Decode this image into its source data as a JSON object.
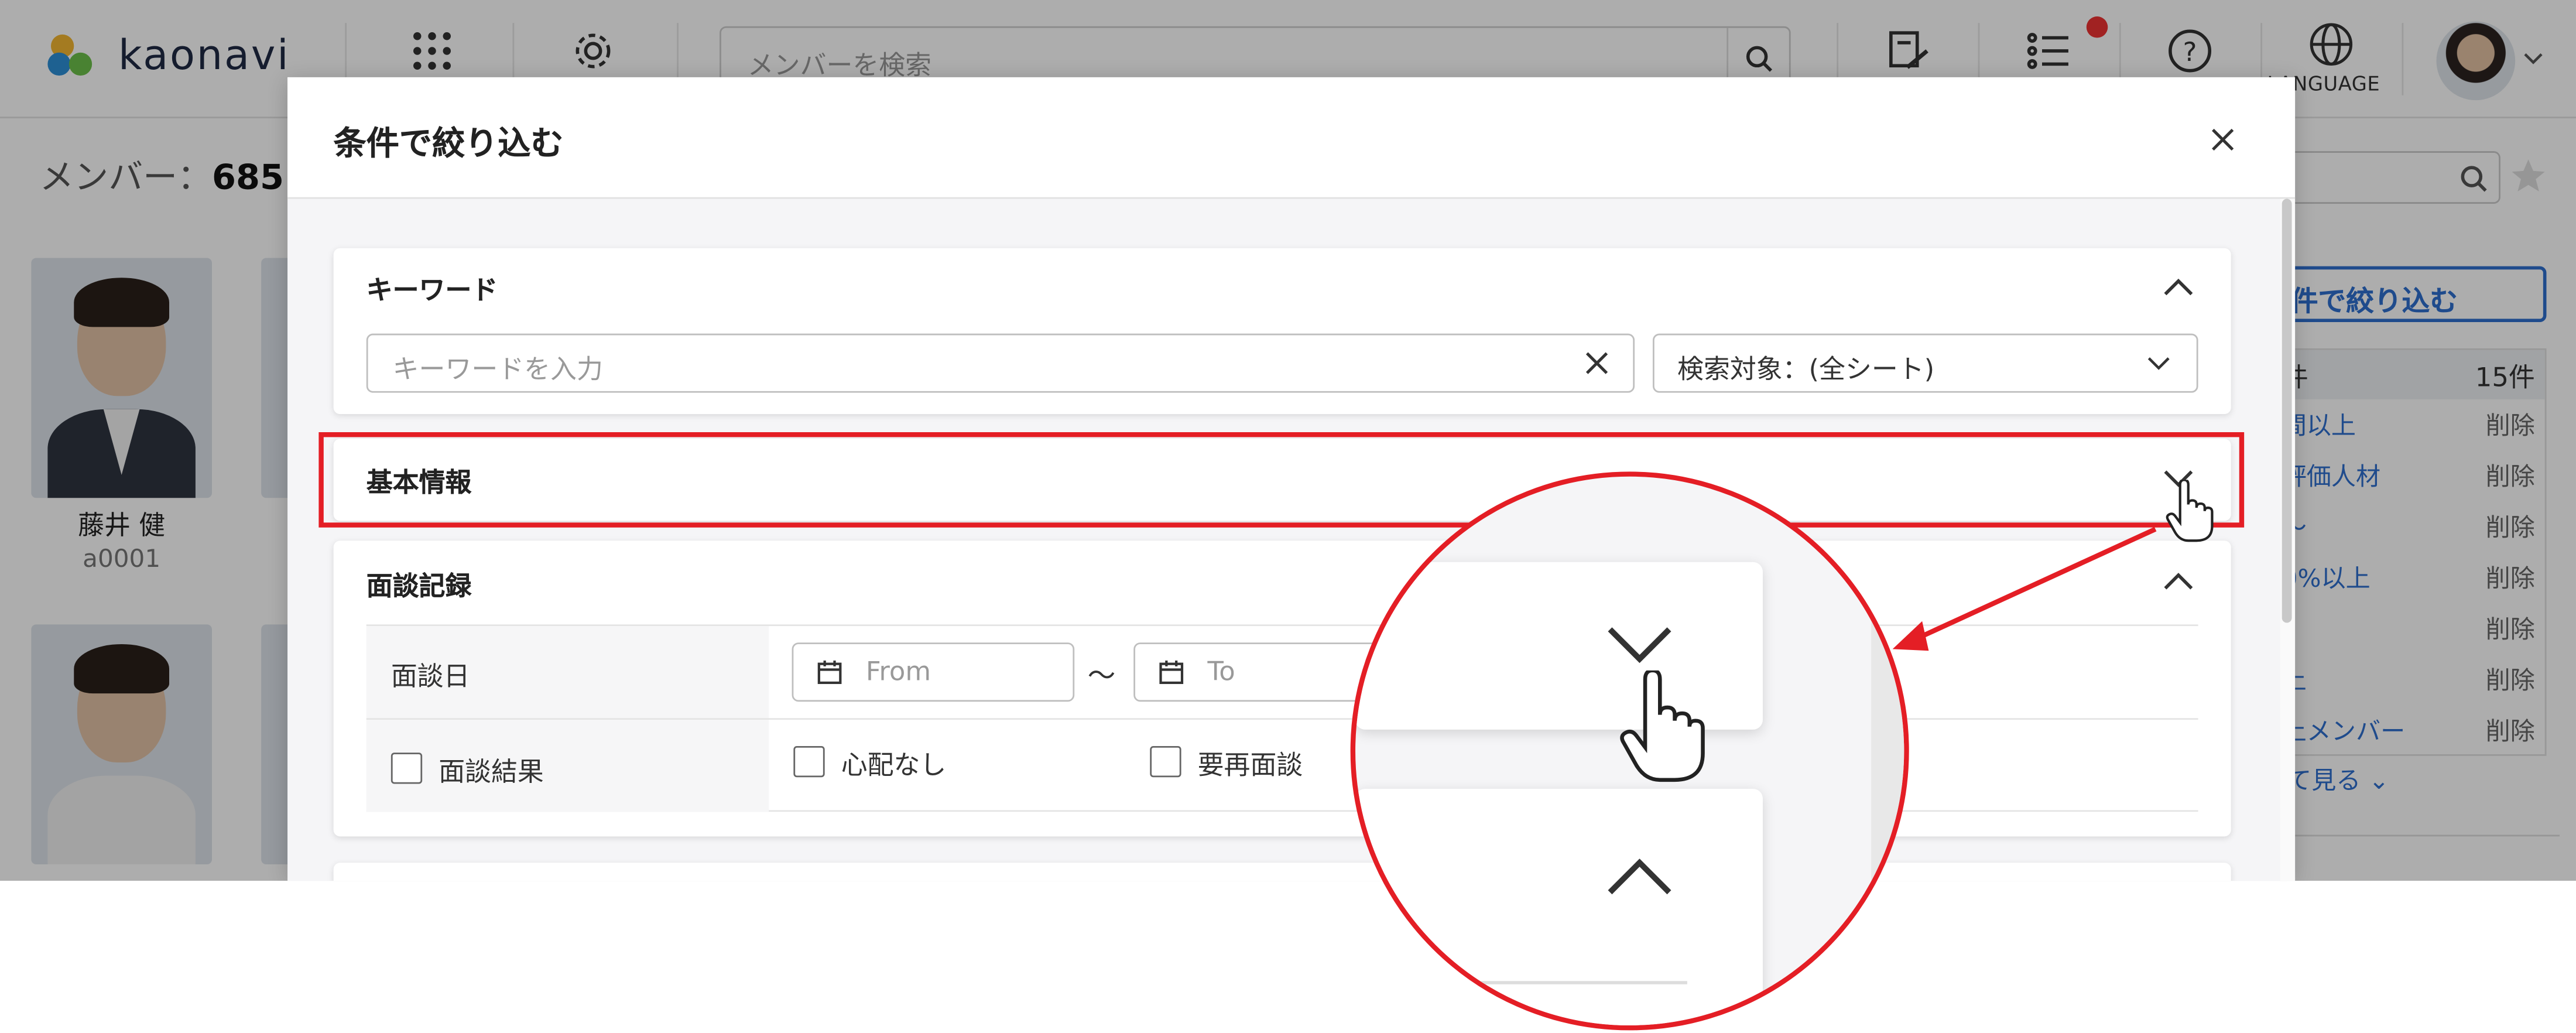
{
  "topbar": {
    "logo_text": "kaonavi",
    "search_placeholder": "メンバーを検索",
    "language_label": "LANGUAGE",
    "icons": [
      "apps-grid-icon",
      "gear-icon",
      "search-icon",
      "task-icon",
      "list-icon",
      "help-icon",
      "globe-icon",
      "avatar"
    ],
    "notification_color": "#e33333"
  },
  "member_list": {
    "title_label": "メンバー：",
    "count": "685",
    "members": [
      {
        "name": "藤井 健",
        "id": "a0001"
      }
    ]
  },
  "right_panel": {
    "filter_button_label": "件で絞り込む",
    "header_label": "件",
    "header_count": "15件",
    "rows": [
      {
        "label": "間以上",
        "action": "削除"
      },
      {
        "label": "評価人材",
        "action": "削除"
      },
      {
        "label": "～",
        "action": "削除"
      },
      {
        "label": "0%以上",
        "action": "削除"
      },
      {
        "label": "",
        "action": "削除"
      },
      {
        "label": "上",
        "action": "削除"
      },
      {
        "label": "上メンバー",
        "action": "削除"
      }
    ],
    "show_more_label": "て見る ⌄"
  },
  "modal": {
    "title": "条件で絞り込む",
    "keyword_section": {
      "label": "キーワード",
      "input_placeholder": "キーワードを入力",
      "search_target_value": "検索対象：(全シート)"
    },
    "basic_info_section": {
      "label": "基本情報",
      "collapsed": true
    },
    "interview_section": {
      "label": "面談記録",
      "date_label": "面談日",
      "from_placeholder": "From",
      "separator": "〜",
      "to_placeholder": "To",
      "result_label": "面談結果",
      "options": [
        "心配なし",
        "要再面談"
      ]
    }
  },
  "annotation": {
    "highlight_color": "#e41e25"
  }
}
